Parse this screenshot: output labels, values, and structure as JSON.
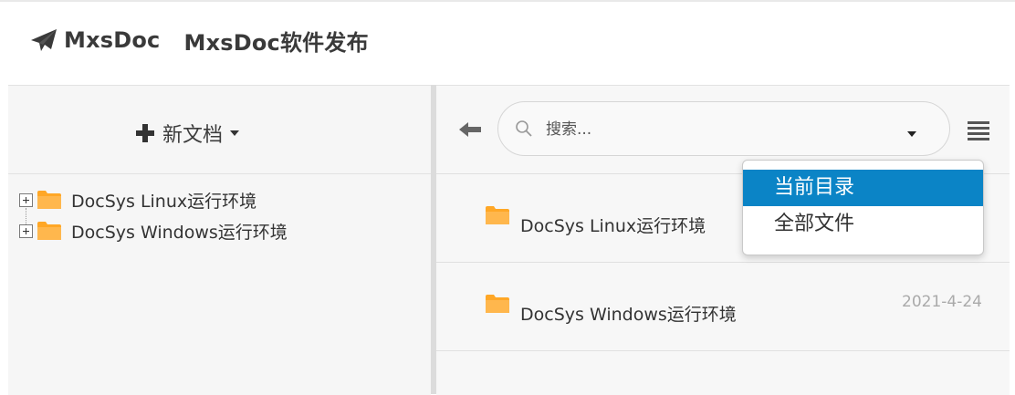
{
  "header": {
    "icon": "paper-plane-icon",
    "repo_name": "MxsDoc",
    "doc_name": "MxsDoc软件发布"
  },
  "left_panel": {
    "new_doc_label": "新文档",
    "new_doc_icon": "plus-icon",
    "tree": [
      {
        "name": "DocSys Linux运行环境",
        "icon": "folder-icon"
      },
      {
        "name": "DocSys Windows运行环境",
        "icon": "folder-icon"
      }
    ]
  },
  "toolbar": {
    "back_icon": "arrow-left-icon",
    "search_placeholder": "搜索...",
    "search_icon": "search-icon",
    "menu_icon": "hamburger-menu-icon"
  },
  "search_scope_dropdown": {
    "options": [
      "当前目录",
      "全部文件"
    ],
    "selected": "当前目录"
  },
  "file_list": [
    {
      "name": "DocSys Linux运行环境",
      "date": ""
    },
    {
      "name": "DocSys Windows运行环境",
      "date": "2021-4-24"
    }
  ],
  "colors": {
    "accent": "#0b84c6",
    "folder": "#ffa726",
    "panel_bg": "#f6f6f6"
  }
}
